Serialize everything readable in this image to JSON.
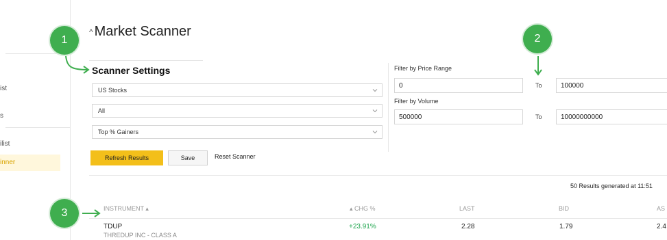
{
  "sidebar": {
    "items": [
      "ist",
      "s",
      "ilist",
      "inner"
    ],
    "active_index": 3
  },
  "markers": [
    "1",
    "2",
    "3"
  ],
  "page": {
    "title": "Market Scanner"
  },
  "settings": {
    "heading": "Scanner Settings",
    "selects": [
      "US Stocks",
      "All",
      "Top % Gainers"
    ]
  },
  "filters": {
    "price_label": "Filter by Price Range",
    "price_from": "0",
    "price_to": "100000",
    "volume_label": "Filter by Volume",
    "volume_from": "500000",
    "volume_to": "10000000000",
    "to_label": "To"
  },
  "actions": {
    "refresh": "Refresh Results",
    "save": "Save",
    "reset": "Reset Scanner"
  },
  "results_text": "50 Results generated at 11:51",
  "table": {
    "headers": {
      "instrument": "INSTRUMENT",
      "chg": "CHG %",
      "last": "LAST",
      "bid": "BID",
      "ask": "AS"
    },
    "rows": [
      {
        "symbol": "TDUP",
        "name": "THREDUP INC - CLASS A",
        "chg": "+23.91%",
        "last": "2.28",
        "bid": "1.79",
        "ask": "2.4"
      }
    ]
  },
  "colors": {
    "accent": "#f3bf1a",
    "marker": "#3fae4f",
    "positive": "#1aa34a"
  }
}
